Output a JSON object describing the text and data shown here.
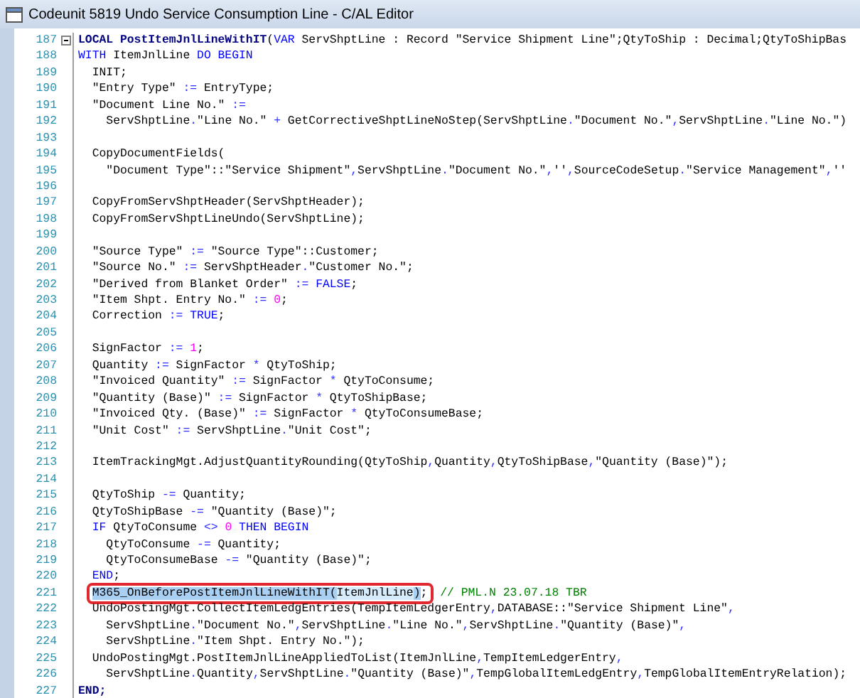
{
  "window": {
    "title": "Codeunit 5819 Undo Service Consumption Line - C/AL Editor"
  },
  "editor": {
    "lines": [
      {
        "no": "187",
        "fold": true,
        "tokens": [
          {
            "kind": "decl",
            "text": "LOCAL PostItemJnlLineWithIT"
          },
          {
            "kind": "p",
            "text": "("
          },
          {
            "kind": "kw",
            "text": "VAR"
          },
          {
            "kind": "p",
            "text": " ServShptLine : Record \"Service Shipment Line\";QtyToShip : Decimal;QtyToShipBas"
          }
        ]
      },
      {
        "no": "188",
        "tokens": [
          {
            "kind": "kw",
            "text": "WITH"
          },
          {
            "kind": "p",
            "text": " ItemJnlLine "
          },
          {
            "kind": "kw",
            "text": "DO BEGIN"
          }
        ]
      },
      {
        "no": "189",
        "tokens": [
          {
            "kind": "p",
            "text": "  INIT;"
          }
        ]
      },
      {
        "no": "190",
        "tokens": [
          {
            "kind": "p",
            "text": "  \"Entry Type\" "
          },
          {
            "kind": "op",
            "text": ":="
          },
          {
            "kind": "p",
            "text": " EntryType;"
          }
        ]
      },
      {
        "no": "191",
        "tokens": [
          {
            "kind": "p",
            "text": "  \"Document Line No.\" "
          },
          {
            "kind": "op",
            "text": ":="
          }
        ]
      },
      {
        "no": "192",
        "tokens": [
          {
            "kind": "p",
            "text": "    ServShptLine"
          },
          {
            "kind": "op",
            "text": "."
          },
          {
            "kind": "p",
            "text": "\"Line No.\" "
          },
          {
            "kind": "op",
            "text": "+"
          },
          {
            "kind": "p",
            "text": " GetCorrectiveShptLineNoStep(ServShptLine"
          },
          {
            "kind": "op",
            "text": "."
          },
          {
            "kind": "p",
            "text": "\"Document No.\""
          },
          {
            "kind": "op",
            "text": ","
          },
          {
            "kind": "p",
            "text": "ServShptLine"
          },
          {
            "kind": "op",
            "text": "."
          },
          {
            "kind": "p",
            "text": "\"Line No.\")"
          }
        ]
      },
      {
        "no": "193"
      },
      {
        "no": "194",
        "tokens": [
          {
            "kind": "p",
            "text": "  CopyDocumentFields("
          }
        ]
      },
      {
        "no": "195",
        "tokens": [
          {
            "kind": "p",
            "text": "    \"Document Type\"::\"Service Shipment\""
          },
          {
            "kind": "op",
            "text": ","
          },
          {
            "kind": "p",
            "text": "ServShptLine"
          },
          {
            "kind": "op",
            "text": "."
          },
          {
            "kind": "p",
            "text": "\"Document No.\""
          },
          {
            "kind": "op",
            "text": ","
          },
          {
            "kind": "p",
            "text": "''"
          },
          {
            "kind": "op",
            "text": ","
          },
          {
            "kind": "p",
            "text": "SourceCodeSetup"
          },
          {
            "kind": "op",
            "text": "."
          },
          {
            "kind": "p",
            "text": "\"Service Management\""
          },
          {
            "kind": "op",
            "text": ","
          },
          {
            "kind": "p",
            "text": "''"
          }
        ]
      },
      {
        "no": "196"
      },
      {
        "no": "197",
        "tokens": [
          {
            "kind": "p",
            "text": "  CopyFromServShptHeader(ServShptHeader);"
          }
        ]
      },
      {
        "no": "198",
        "tokens": [
          {
            "kind": "p",
            "text": "  CopyFromServShptLineUndo(ServShptLine);"
          }
        ]
      },
      {
        "no": "199"
      },
      {
        "no": "200",
        "tokens": [
          {
            "kind": "p",
            "text": "  \"Source Type\" "
          },
          {
            "kind": "op",
            "text": ":="
          },
          {
            "kind": "p",
            "text": " \"Source Type\"::Customer;"
          }
        ]
      },
      {
        "no": "201",
        "tokens": [
          {
            "kind": "p",
            "text": "  \"Source No.\" "
          },
          {
            "kind": "op",
            "text": ":="
          },
          {
            "kind": "p",
            "text": " ServShptHeader"
          },
          {
            "kind": "op",
            "text": "."
          },
          {
            "kind": "p",
            "text": "\"Customer No.\";"
          }
        ]
      },
      {
        "no": "202",
        "tokens": [
          {
            "kind": "p",
            "text": "  \"Derived from Blanket Order\" "
          },
          {
            "kind": "op",
            "text": ":= "
          },
          {
            "kind": "kw",
            "text": "FALSE"
          },
          {
            "kind": "p",
            "text": ";"
          }
        ]
      },
      {
        "no": "203",
        "tokens": [
          {
            "kind": "p",
            "text": "  \"Item Shpt. Entry No.\" "
          },
          {
            "kind": "op",
            "text": ":= "
          },
          {
            "kind": "num",
            "text": "0"
          },
          {
            "kind": "p",
            "text": ";"
          }
        ]
      },
      {
        "no": "204",
        "tokens": [
          {
            "kind": "p",
            "text": "  Correction "
          },
          {
            "kind": "op",
            "text": ":= "
          },
          {
            "kind": "kw",
            "text": "TRUE"
          },
          {
            "kind": "p",
            "text": ";"
          }
        ]
      },
      {
        "no": "205"
      },
      {
        "no": "206",
        "tokens": [
          {
            "kind": "p",
            "text": "  SignFactor "
          },
          {
            "kind": "op",
            "text": ":= "
          },
          {
            "kind": "num",
            "text": "1"
          },
          {
            "kind": "p",
            "text": ";"
          }
        ]
      },
      {
        "no": "207",
        "tokens": [
          {
            "kind": "p",
            "text": "  Quantity "
          },
          {
            "kind": "op",
            "text": ":="
          },
          {
            "kind": "p",
            "text": " SignFactor "
          },
          {
            "kind": "op",
            "text": "*"
          },
          {
            "kind": "p",
            "text": " QtyToShip;"
          }
        ]
      },
      {
        "no": "208",
        "tokens": [
          {
            "kind": "p",
            "text": "  \"Invoiced Quantity\" "
          },
          {
            "kind": "op",
            "text": ":="
          },
          {
            "kind": "p",
            "text": " SignFactor "
          },
          {
            "kind": "op",
            "text": "*"
          },
          {
            "kind": "p",
            "text": " QtyToConsume;"
          }
        ]
      },
      {
        "no": "209",
        "tokens": [
          {
            "kind": "p",
            "text": "  \"Quantity (Base)\" "
          },
          {
            "kind": "op",
            "text": ":="
          },
          {
            "kind": "p",
            "text": " SignFactor "
          },
          {
            "kind": "op",
            "text": "*"
          },
          {
            "kind": "p",
            "text": " QtyToShipBase;"
          }
        ]
      },
      {
        "no": "210",
        "tokens": [
          {
            "kind": "p",
            "text": "  \"Invoiced Qty. (Base)\" "
          },
          {
            "kind": "op",
            "text": ":="
          },
          {
            "kind": "p",
            "text": " SignFactor "
          },
          {
            "kind": "op",
            "text": "*"
          },
          {
            "kind": "p",
            "text": " QtyToConsumeBase;"
          }
        ]
      },
      {
        "no": "211",
        "tokens": [
          {
            "kind": "p",
            "text": "  \"Unit Cost\" "
          },
          {
            "kind": "op",
            "text": ":="
          },
          {
            "kind": "p",
            "text": " ServShptLine"
          },
          {
            "kind": "op",
            "text": "."
          },
          {
            "kind": "p",
            "text": "\"Unit Cost\";"
          }
        ]
      },
      {
        "no": "212"
      },
      {
        "no": "213",
        "tokens": [
          {
            "kind": "p",
            "text": "  ItemTrackingMgt.AdjustQuantityRounding(QtyToShip"
          },
          {
            "kind": "op",
            "text": ","
          },
          {
            "kind": "p",
            "text": "Quantity"
          },
          {
            "kind": "op",
            "text": ","
          },
          {
            "kind": "p",
            "text": "QtyToShipBase"
          },
          {
            "kind": "op",
            "text": ","
          },
          {
            "kind": "p",
            "text": "\"Quantity (Base)\");"
          }
        ]
      },
      {
        "no": "214"
      },
      {
        "no": "215",
        "tokens": [
          {
            "kind": "p",
            "text": "  QtyToShip "
          },
          {
            "kind": "op",
            "text": "-="
          },
          {
            "kind": "p",
            "text": " Quantity;"
          }
        ]
      },
      {
        "no": "216",
        "tokens": [
          {
            "kind": "p",
            "text": "  QtyToShipBase "
          },
          {
            "kind": "op",
            "text": "-="
          },
          {
            "kind": "p",
            "text": " \"Quantity (Base)\";"
          }
        ]
      },
      {
        "no": "217",
        "tokens": [
          {
            "kind": "kw",
            "text": "  IF"
          },
          {
            "kind": "p",
            "text": " QtyToConsume "
          },
          {
            "kind": "op",
            "text": "<> "
          },
          {
            "kind": "num",
            "text": "0 "
          },
          {
            "kind": "kw",
            "text": "THEN BEGIN"
          }
        ]
      },
      {
        "no": "218",
        "tokens": [
          {
            "kind": "p",
            "text": "    QtyToConsume "
          },
          {
            "kind": "op",
            "text": "-="
          },
          {
            "kind": "p",
            "text": " Quantity;"
          }
        ]
      },
      {
        "no": "219",
        "tokens": [
          {
            "kind": "p",
            "text": "    QtyToConsumeBase "
          },
          {
            "kind": "op",
            "text": "-="
          },
          {
            "kind": "p",
            "text": " \"Quantity (Base)\";"
          }
        ]
      },
      {
        "no": "220",
        "tokens": [
          {
            "kind": "kw",
            "text": "  END"
          },
          {
            "kind": "p",
            "text": ";"
          }
        ]
      },
      {
        "no": "221",
        "boxed": [
          {
            "kind": "sel",
            "text": "M365_OnBeforePostItemJnlLineWithIT("
          },
          {
            "kind": "match",
            "text": "ItemJnlLine"
          },
          {
            "kind": "sel",
            "text": ")"
          },
          {
            "kind": "p",
            "text": ";"
          }
        ],
        "tokens": [
          {
            "kind": "cm",
            "text": " // PML.N 23.07.18 TBR"
          }
        ]
      },
      {
        "no": "222",
        "tokens": [
          {
            "kind": "p",
            "text": "  UndoPostingMgt.CollectItemLedgEntries(TempItemLedgerEntry"
          },
          {
            "kind": "op",
            "text": ","
          },
          {
            "kind": "p",
            "text": "DATABASE::\"Service Shipment Line\""
          },
          {
            "kind": "op",
            "text": ","
          }
        ]
      },
      {
        "no": "223",
        "tokens": [
          {
            "kind": "p",
            "text": "    ServShptLine"
          },
          {
            "kind": "op",
            "text": "."
          },
          {
            "kind": "p",
            "text": "\"Document No.\""
          },
          {
            "kind": "op",
            "text": ","
          },
          {
            "kind": "p",
            "text": "ServShptLine"
          },
          {
            "kind": "op",
            "text": "."
          },
          {
            "kind": "p",
            "text": "\"Line No.\""
          },
          {
            "kind": "op",
            "text": ","
          },
          {
            "kind": "p",
            "text": "ServShptLine"
          },
          {
            "kind": "op",
            "text": "."
          },
          {
            "kind": "p",
            "text": "\"Quantity (Base)\""
          },
          {
            "kind": "op",
            "text": ","
          }
        ]
      },
      {
        "no": "224",
        "tokens": [
          {
            "kind": "p",
            "text": "    ServShptLine"
          },
          {
            "kind": "op",
            "text": "."
          },
          {
            "kind": "p",
            "text": "\"Item Shpt. Entry No.\");"
          }
        ]
      },
      {
        "no": "225",
        "tokens": [
          {
            "kind": "p",
            "text": "  UndoPostingMgt.PostItemJnlLineAppliedToList(ItemJnlLine"
          },
          {
            "kind": "op",
            "text": ","
          },
          {
            "kind": "p",
            "text": "TempItemLedgerEntry"
          },
          {
            "kind": "op",
            "text": ","
          }
        ]
      },
      {
        "no": "226",
        "tokens": [
          {
            "kind": "p",
            "text": "    ServShptLine"
          },
          {
            "kind": "op",
            "text": "."
          },
          {
            "kind": "p",
            "text": "Quantity"
          },
          {
            "kind": "op",
            "text": ","
          },
          {
            "kind": "p",
            "text": "ServShptLine"
          },
          {
            "kind": "op",
            "text": "."
          },
          {
            "kind": "p",
            "text": "\"Quantity (Base)\""
          },
          {
            "kind": "op",
            "text": ","
          },
          {
            "kind": "p",
            "text": "TempGlobalItemLedgEntry"
          },
          {
            "kind": "op",
            "text": ","
          },
          {
            "kind": "p",
            "text": "TempGlobalItemEntryRelation);"
          }
        ]
      },
      {
        "no": "227",
        "tokens": [
          {
            "kind": "decl",
            "text": "END;"
          }
        ]
      }
    ]
  }
}
